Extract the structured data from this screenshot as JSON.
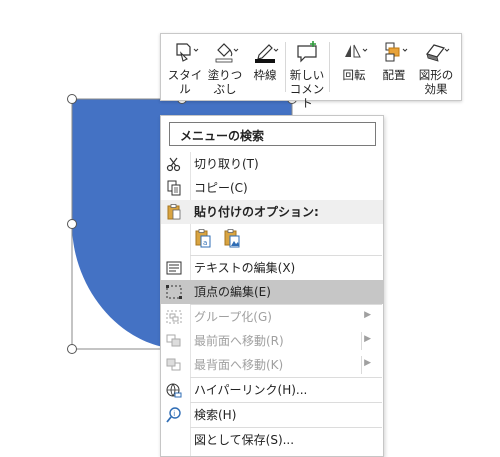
{
  "toolbar": {
    "style": "スタイル",
    "fill": "塗りつ\nぶし",
    "outline": "枠線",
    "new_comment": "新しい\nコメント",
    "rotate": "回転",
    "arrange": "配置",
    "shape_effects": "図形の\n効果"
  },
  "menu": {
    "search_placeholder": "メニューの検索",
    "cut": "切り取り(T)",
    "copy": "コピー(C)",
    "paste_options": "貼り付けのオプション:",
    "edit_text": "テキストの編集(X)",
    "edit_points": "頂点の編集(E)",
    "group": "グループ化(G)",
    "bring_to_front": "最前面へ移動(R)",
    "send_to_back": "最背面へ移動(K)",
    "hyperlink": "ハイパーリンク(H)...",
    "search": "検索(H)",
    "save_as_picture": "図として保存(S)..."
  },
  "colors": {
    "shape_fill": "#4472c4",
    "menu_hover": "#c6c6c6",
    "menu_header": "#efefef",
    "disabled_text": "#a0a0a0",
    "paste_icon": "#2f6db5"
  }
}
